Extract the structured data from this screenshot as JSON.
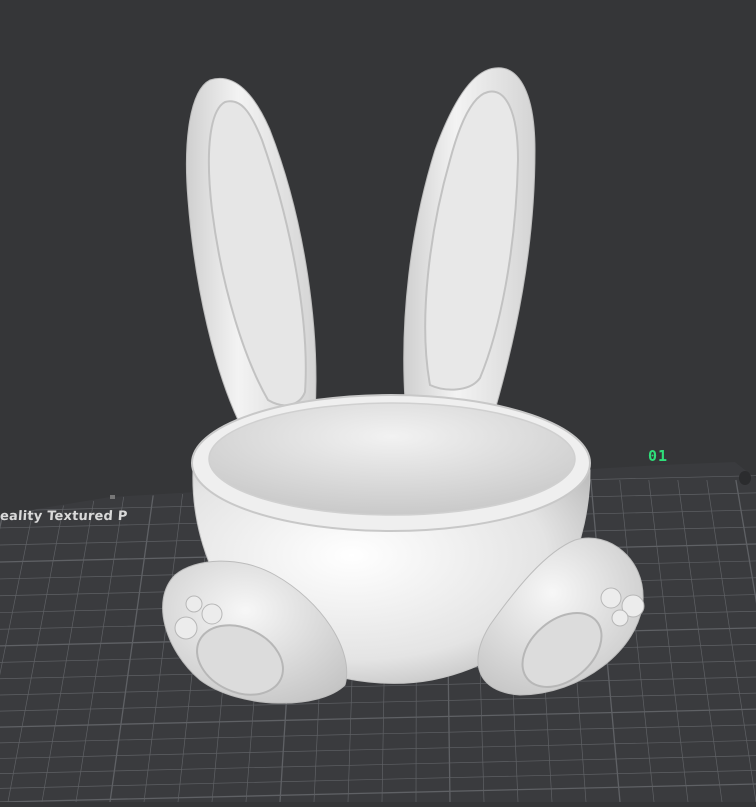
{
  "viewport": {
    "background_color": "#353638",
    "bed_color": "#3a3b3e",
    "grid_color": "#5f6165",
    "model_color": "#e8e8e8"
  },
  "build_plate": {
    "label": "eality Textured P",
    "plate_index": "01",
    "index_color": "#2ee07a"
  },
  "model": {
    "name_icon": "bunny-bowl-model"
  }
}
